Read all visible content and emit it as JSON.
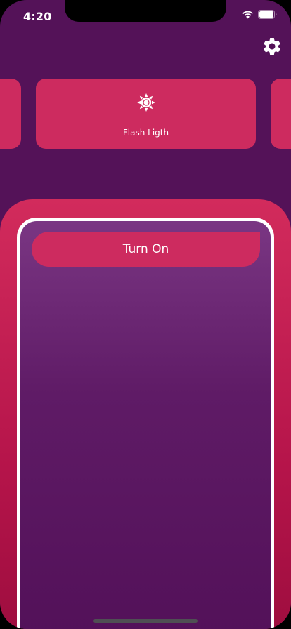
{
  "status_bar": {
    "time": "4:20"
  },
  "settings": {
    "icon": "gear-icon"
  },
  "mode_carousel": {
    "current": {
      "label": "Flash Ligth",
      "icon": "sun-icon"
    }
  },
  "controls": {
    "turn_on_label": "Turn On"
  },
  "colors": {
    "background": "#541258",
    "card": "#cd2b5f",
    "panel_top": "#d22b5c",
    "panel_bottom": "#9c0d3e",
    "inner_top": "#7a3683",
    "inner_bottom": "#521058",
    "text": "#ffffff"
  }
}
